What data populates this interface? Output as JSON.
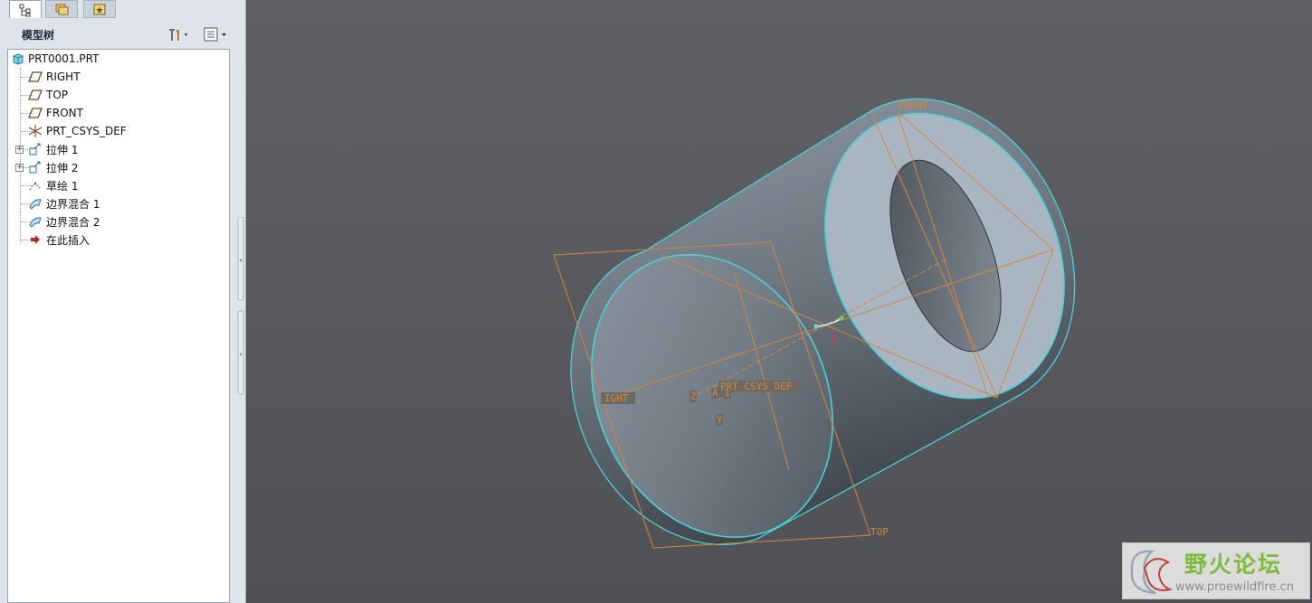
{
  "model_tree": {
    "title": "模型树",
    "items": [
      {
        "label": "PRT0001.PRT",
        "icon": "part-icon",
        "expandable": false
      },
      {
        "label": "RIGHT",
        "icon": "datum-plane-icon",
        "expandable": false
      },
      {
        "label": "TOP",
        "icon": "datum-plane-icon",
        "expandable": false
      },
      {
        "label": "FRONT",
        "icon": "datum-plane-icon",
        "expandable": false
      },
      {
        "label": "PRT_CSYS_DEF",
        "icon": "csys-icon",
        "expandable": false
      },
      {
        "label": "拉伸 1",
        "icon": "extrude-icon",
        "expandable": true
      },
      {
        "label": "拉伸 2",
        "icon": "extrude-icon",
        "expandable": true
      },
      {
        "label": "草绘 1",
        "icon": "sketch-icon",
        "expandable": false
      },
      {
        "label": "边界混合 1",
        "icon": "boundary-blend-icon",
        "expandable": false
      },
      {
        "label": "边界混合 2",
        "icon": "boundary-blend-icon",
        "expandable": false
      },
      {
        "label": "在此插入",
        "icon": "insert-here-arrow-icon",
        "expandable": false
      }
    ]
  },
  "viewport": {
    "datum_labels": {
      "front": "FRONT",
      "right": "IGHT",
      "top": "TOP",
      "csys": "PRT_CSYS_DEF",
      "axis_a": "A_1",
      "axis_z": "Z",
      "axis_y": "Y"
    },
    "colors": {
      "datum": "#d3873a",
      "edge": "#46d3dc",
      "face": "#a9b6c1"
    }
  },
  "watermark": {
    "title": "野火论坛",
    "url": "www.proewildfire.cn"
  }
}
